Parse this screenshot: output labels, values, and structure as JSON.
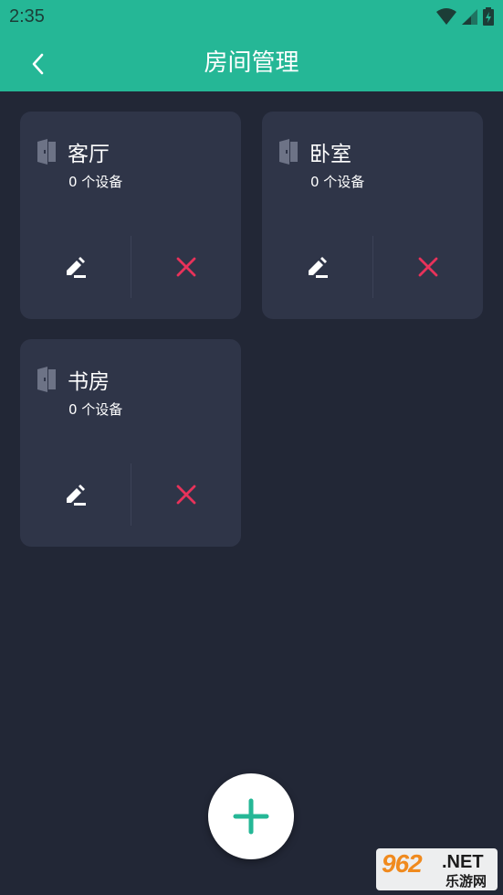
{
  "status_bar": {
    "time": "2:35"
  },
  "header": {
    "title": "房间管理",
    "back_icon": "chevron-left-icon"
  },
  "rooms": [
    {
      "name": "客厅",
      "device_count": "0 个设备"
    },
    {
      "name": "卧室",
      "device_count": "0 个设备"
    },
    {
      "name": "书房",
      "device_count": "0 个设备"
    }
  ],
  "fab": {
    "icon": "plus-icon"
  },
  "watermark": {
    "number": "962",
    "suffix": ".NET",
    "site_name": "乐游网"
  },
  "colors": {
    "accent": "#25b796",
    "background": "#222736",
    "card": "#2f3548",
    "delete": "#e8325a"
  }
}
